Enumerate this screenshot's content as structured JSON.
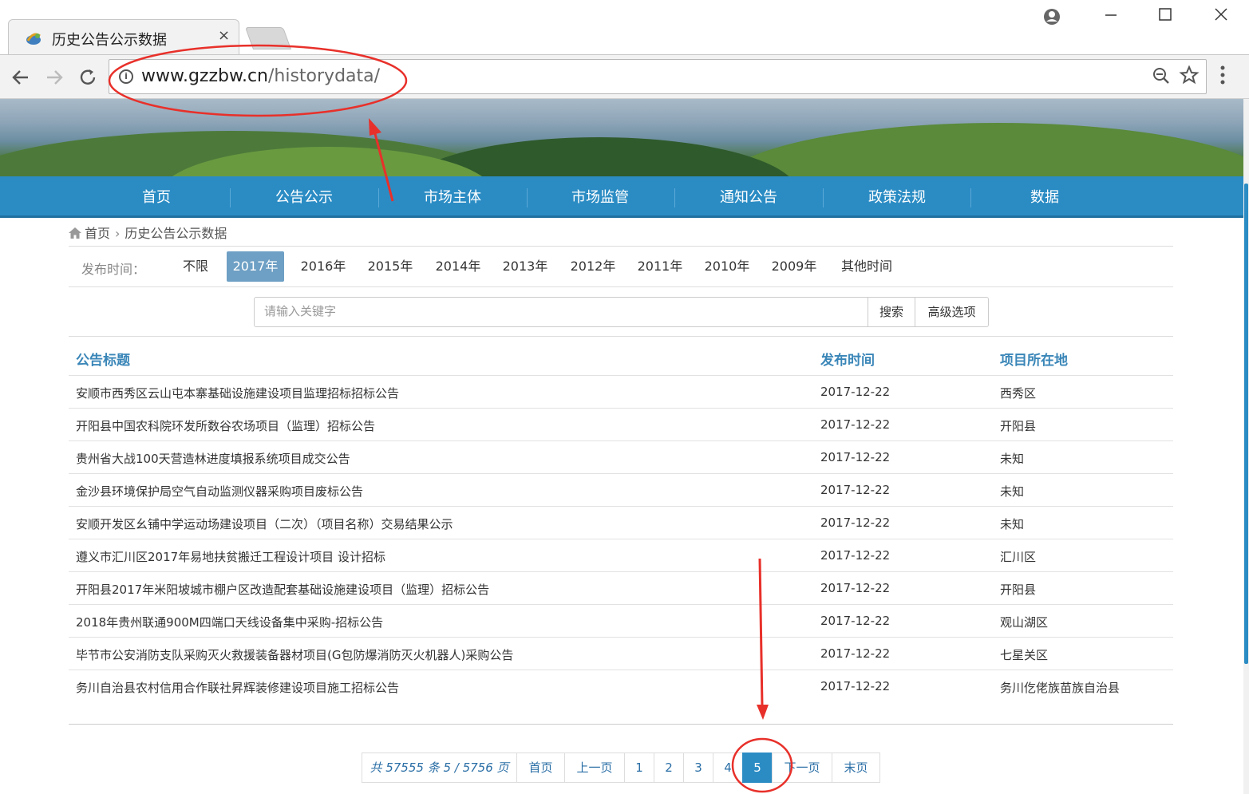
{
  "browser": {
    "tab_title": "历史公告公示数据",
    "tab_close": "×",
    "url_host": "www.gzzbw.cn",
    "url_path": "/historydata/",
    "icons": [
      "back-icon",
      "forward-icon",
      "reload-icon",
      "info-icon",
      "zoom-icon",
      "star-icon",
      "menu-icon",
      "account-icon",
      "minimize-icon",
      "maximize-icon",
      "close-icon"
    ]
  },
  "nav": {
    "items": [
      "首页",
      "公告公示",
      "市场主体",
      "市场监管",
      "通知公告",
      "政策法规",
      "数据"
    ]
  },
  "breadcrumb": {
    "home": "首页",
    "current": "历史公告公示数据"
  },
  "filter": {
    "label": "发布时间：",
    "years": [
      "不限",
      "2017年",
      "2016年",
      "2015年",
      "2014年",
      "2013年",
      "2012年",
      "2011年",
      "2010年",
      "2009年",
      "其他时间"
    ],
    "active": "2017年"
  },
  "search": {
    "placeholder": "请输入关键字",
    "search_label": "搜索",
    "advanced_label": "高级选项"
  },
  "table": {
    "headers": [
      "公告标题",
      "发布时间",
      "项目所在地"
    ],
    "rows": [
      {
        "title": "安顺市西秀区云山屯本寨基础设施建设项目监理招标招标公告",
        "date": "2017-12-22",
        "location": "西秀区"
      },
      {
        "title": "开阳县中国农科院环发所数谷农场项目（监理）招标公告",
        "date": "2017-12-22",
        "location": "开阳县"
      },
      {
        "title": "贵州省大战100天营造林进度填报系统项目成交公告",
        "date": "2017-12-22",
        "location": "未知"
      },
      {
        "title": "金沙县环境保护局空气自动监测仪器采购项目废标公告",
        "date": "2017-12-22",
        "location": "未知"
      },
      {
        "title": "安顺开发区幺铺中学运动场建设项目（二次）（项目名称）交易结果公示",
        "date": "2017-12-22",
        "location": "未知"
      },
      {
        "title": "遵义市汇川区2017年易地扶贫搬迁工程设计项目 设计招标",
        "date": "2017-12-22",
        "location": "汇川区"
      },
      {
        "title": "开阳县2017年米阳坡城市棚户区改造配套基础设施建设项目（监理）招标公告",
        "date": "2017-12-22",
        "location": "开阳县"
      },
      {
        "title": "2018年贵州联通900M四端口天线设备集中采购-招标公告",
        "date": "2017-12-22",
        "location": "观山湖区"
      },
      {
        "title": "毕节市公安消防支队采购灭火救援装备器材项目(G包防爆消防灭火机器人)采购公告",
        "date": "2017-12-22",
        "location": "七星关区"
      },
      {
        "title": "务川自治县农村信用合作联社昇辉装修建设项目施工招标公告",
        "date": "2017-12-22",
        "location": "务川仡佬族苗族自治县"
      }
    ]
  },
  "pagination": {
    "info": "共 57555 条 5 / 5756 页",
    "first": "首页",
    "prev": "上一页",
    "pages": [
      "1",
      "2",
      "3",
      "4",
      "5"
    ],
    "current": "5",
    "next": "下一页",
    "last": "末页"
  },
  "colors": {
    "nav_bg": "#2b8cc4",
    "active_year": "#6e9fc4",
    "header_text": "#3a86b8",
    "annotation": "#e8302a"
  }
}
